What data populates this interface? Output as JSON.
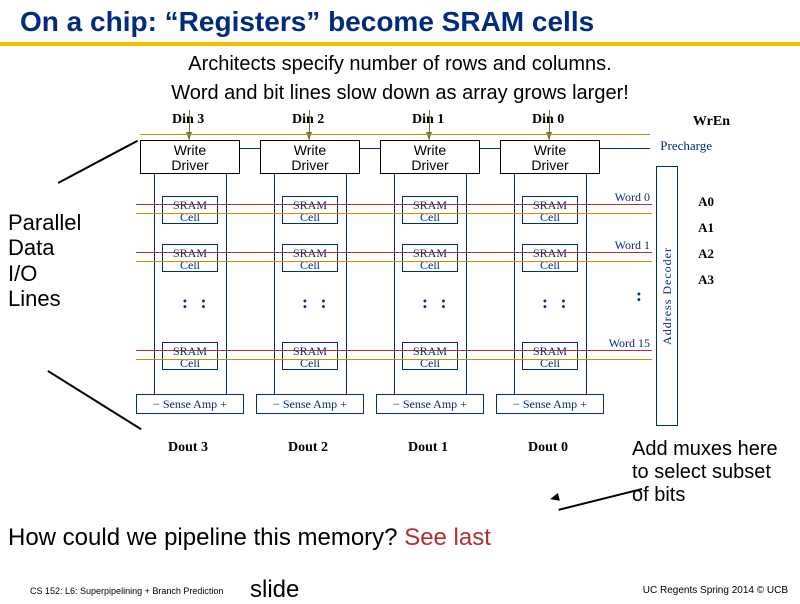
{
  "title": "On a chip: “Registers” become SRAM cells",
  "subtitle_line1": "Architects specify number of rows and columns.",
  "subtitle_line2": "Word and bit lines slow down as array grows larger!",
  "din": [
    "Din 3",
    "Din 2",
    "Din 1",
    "Din 0"
  ],
  "wren": "WrEn",
  "precharge": "Precharge",
  "write_driver": "Write\nDriver",
  "sram_cell": "SRAM\nCell",
  "sense_amp_minus": "−",
  "sense_amp_plus": "+",
  "sense_amp": "Sense Amp",
  "dout": [
    "Dout 3",
    "Dout 2",
    "Dout 1",
    "Dout 0"
  ],
  "word_labels": [
    "Word 0",
    "Word 1",
    "Word 15"
  ],
  "a_labels": [
    "A0",
    "A1",
    "A2",
    "A3"
  ],
  "addr_decoder": "Address Decoder",
  "parallel": "Parallel\nData\nI/O\nLines",
  "muxes": "Add muxes here to select subset of bits",
  "question_black": "How could we pipeline this memory? ",
  "question_red": "See last",
  "slide_word": "slide",
  "footer_left": "CS 152: L6: Superpipelining + Branch Prediction",
  "footer_right": "UC Regents Spring 2014 © UCB"
}
